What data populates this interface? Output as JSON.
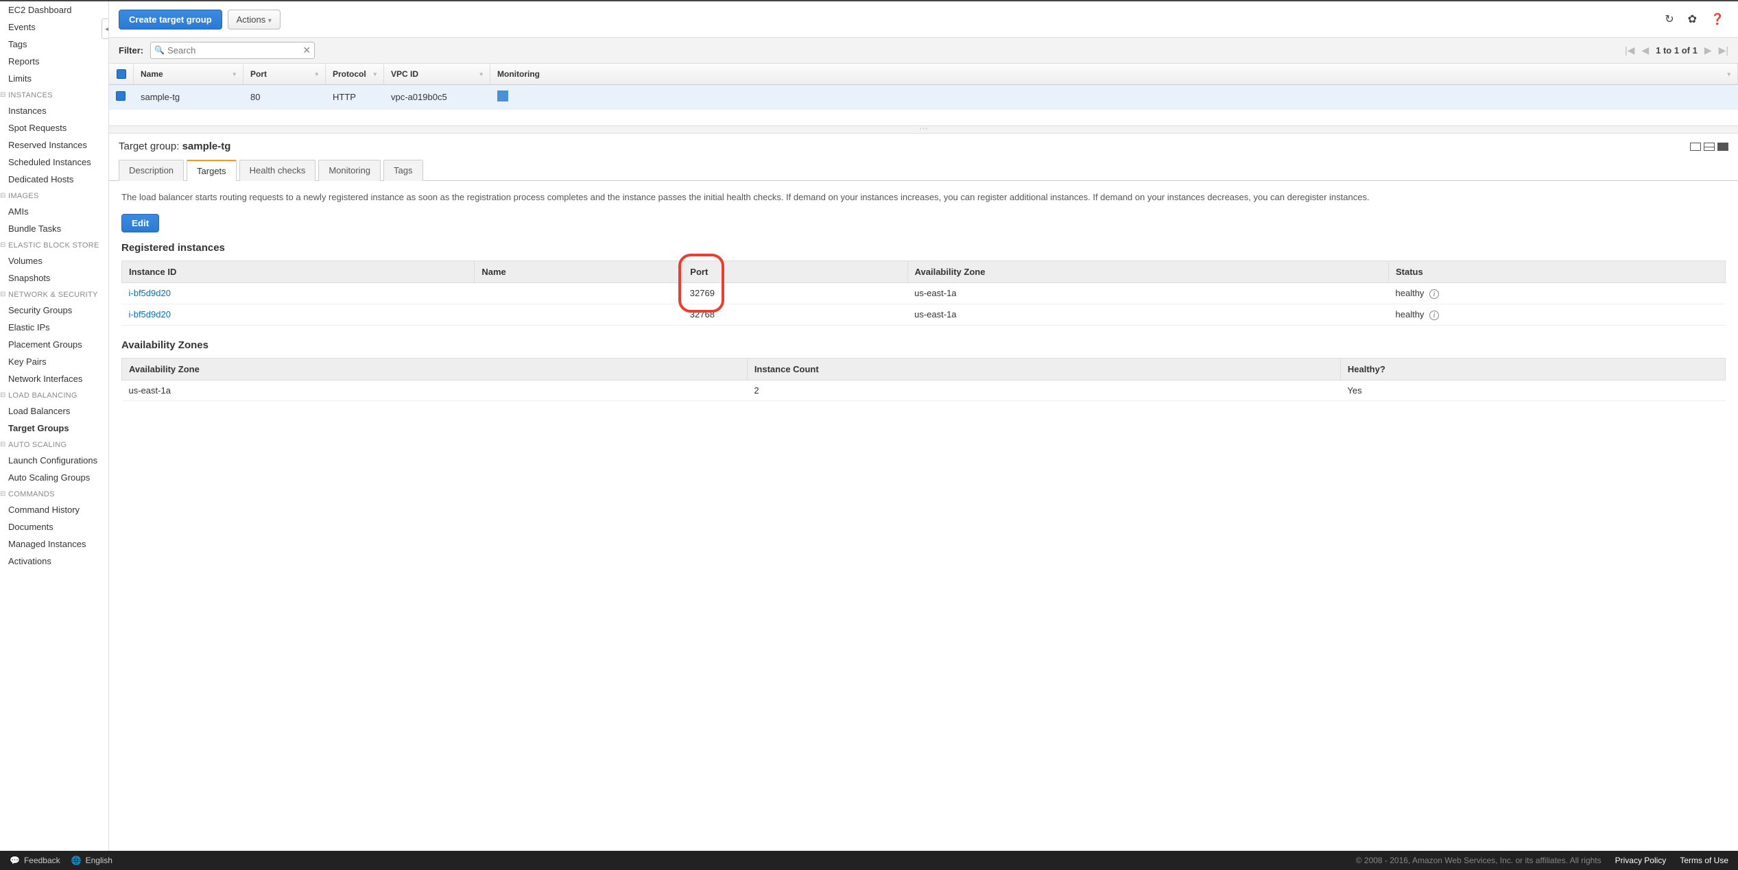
{
  "sidebar": {
    "top": [
      "EC2 Dashboard",
      "Events",
      "Tags",
      "Reports",
      "Limits"
    ],
    "sections": [
      {
        "header": "INSTANCES",
        "items": [
          "Instances",
          "Spot Requests",
          "Reserved Instances",
          "Scheduled Instances",
          "Dedicated Hosts"
        ]
      },
      {
        "header": "IMAGES",
        "items": [
          "AMIs",
          "Bundle Tasks"
        ]
      },
      {
        "header": "ELASTIC BLOCK STORE",
        "items": [
          "Volumes",
          "Snapshots"
        ]
      },
      {
        "header": "NETWORK & SECURITY",
        "items": [
          "Security Groups",
          "Elastic IPs",
          "Placement Groups",
          "Key Pairs",
          "Network Interfaces"
        ]
      },
      {
        "header": "LOAD BALANCING",
        "items": [
          "Load Balancers",
          "Target Groups"
        ]
      },
      {
        "header": "AUTO SCALING",
        "items": [
          "Launch Configurations",
          "Auto Scaling Groups"
        ]
      },
      {
        "header": "COMMANDS",
        "items": [
          "Command History",
          "Documents",
          "Managed Instances",
          "Activations"
        ]
      }
    ],
    "active": "Target Groups"
  },
  "toolbar": {
    "create": "Create target group",
    "actions": "Actions"
  },
  "filter": {
    "label": "Filter:",
    "placeholder": "Search",
    "pager": "1 to 1 of 1"
  },
  "table": {
    "headers": {
      "name": "Name",
      "port": "Port",
      "protocol": "Protocol",
      "vpc": "VPC ID",
      "monitoring": "Monitoring"
    },
    "row": {
      "name": "sample-tg",
      "port": "80",
      "protocol": "HTTP",
      "vpc": "vpc-a019b0c5"
    }
  },
  "detail": {
    "title_prefix": "Target group: ",
    "title_name": "sample-tg",
    "tabs": [
      "Description",
      "Targets",
      "Health checks",
      "Monitoring",
      "Tags"
    ],
    "active_tab": "Targets",
    "description": "The load balancer starts routing requests to a newly registered instance as soon as the registration process completes and the instance passes the initial health checks. If demand on your instances increases, you can register additional instances. If demand on your instances decreases, you can deregister instances.",
    "edit": "Edit",
    "reg_title": "Registered instances",
    "reg_headers": {
      "id": "Instance ID",
      "name": "Name",
      "port": "Port",
      "az": "Availability Zone",
      "status": "Status"
    },
    "reg_rows": [
      {
        "id": "i-bf5d9d20",
        "name": "",
        "port": "32769",
        "az": "us-east-1a",
        "status": "healthy"
      },
      {
        "id": "i-bf5d9d20",
        "name": "",
        "port": "32768",
        "az": "us-east-1a",
        "status": "healthy"
      }
    ],
    "az_title": "Availability Zones",
    "az_headers": {
      "az": "Availability Zone",
      "count": "Instance Count",
      "healthy": "Healthy?"
    },
    "az_rows": [
      {
        "az": "us-east-1a",
        "count": "2",
        "healthy": "Yes"
      }
    ]
  },
  "footer": {
    "feedback": "Feedback",
    "lang": "English",
    "copyright": "© 2008 - 2016, Amazon Web Services, Inc. or its affiliates. All rights",
    "privacy": "Privacy Policy",
    "terms": "Terms of Use"
  }
}
